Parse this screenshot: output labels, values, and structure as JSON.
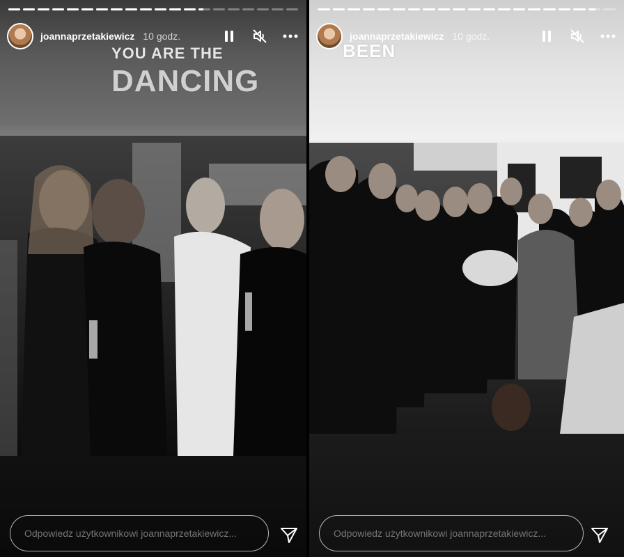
{
  "stories": [
    {
      "username": "joannaprzetakiewicz",
      "time": "10 godz.",
      "captions": [
        "YOU ARE THE",
        "DANCING"
      ],
      "progress": [
        1,
        1,
        1,
        1,
        1,
        1,
        1,
        1,
        1,
        1,
        1,
        1,
        1,
        0.4,
        0,
        0,
        0,
        0,
        0,
        0
      ],
      "reply_placeholder": "Odpowiedz użytkownikowi joannaprzetakiewicz..."
    },
    {
      "username": "joannaprzetakiewicz",
      "time": "10 godz.",
      "captions": [
        "BEEN"
      ],
      "progress": [
        1,
        1,
        1,
        1,
        1,
        1,
        1,
        1,
        1,
        1,
        1,
        1,
        1,
        1,
        1,
        1,
        1,
        1,
        0.6,
        0
      ],
      "reply_placeholder": "Odpowiedz użytkownikowi joannaprzetakiewicz..."
    }
  ],
  "icons": {
    "pause": "pause-icon",
    "mute": "speaker-muted-icon",
    "more": "more-dots-icon",
    "send": "paper-plane-icon"
  }
}
